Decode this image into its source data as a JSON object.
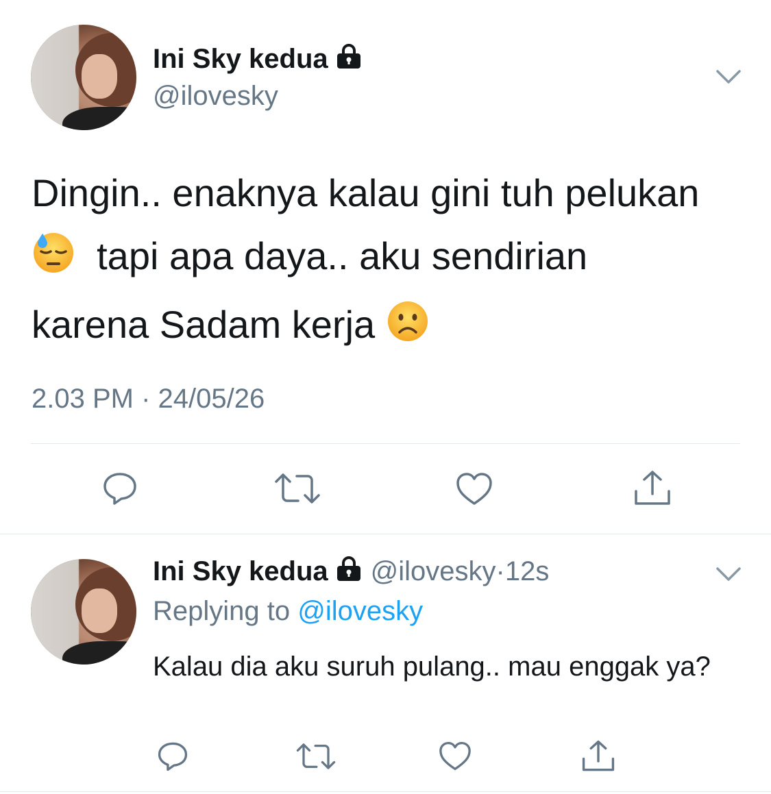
{
  "tweet": {
    "author_name": "Ini Sky kedua",
    "author_handle": "@ilovesky",
    "text_line1": "Dingin.. enaknya kalau gini tuh pelukan",
    "text_line2": "tapi apa daya.. aku sendirian",
    "text_line3": "karena Sadam kerja",
    "emoji1": "downcast-face-with-sweat",
    "emoji2": "frowning-face",
    "time": "2.03 PM",
    "separator": "·",
    "date": "24/05/26",
    "icons": [
      "reply-icon",
      "retweet-icon",
      "like-icon",
      "share-icon",
      "lock-icon",
      "chevron-down-icon"
    ]
  },
  "reply": {
    "author_name": "Ini Sky kedua",
    "author_handle": "@ilovesky",
    "separator": "·",
    "age": "12s",
    "replying_prefix": "Replying to",
    "replying_to": "@ilovesky",
    "text": "Kalau dia aku suruh pulang.. mau enggak ya?"
  },
  "colors": {
    "text": "#14171a",
    "secondary": "#657786",
    "link": "#1da1f2",
    "divider": "#e1e8ed"
  }
}
